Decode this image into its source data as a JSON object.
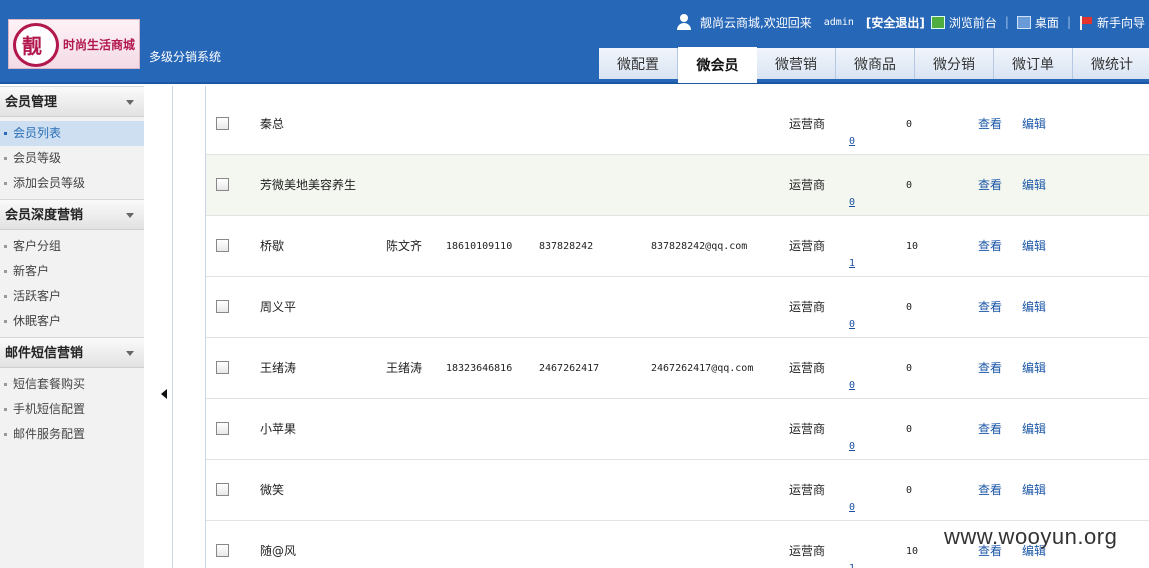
{
  "brand": {
    "logo_mark": "靓",
    "logo_text": "时尚生活商城",
    "system_name": "多级分销系统"
  },
  "topbar": {
    "welcome": "靓尚云商城,欢迎回来",
    "user": "admin",
    "logout": "[安全退出]",
    "browse_frontend": "浏览前台",
    "desktop": "桌面",
    "guide": "新手向导",
    "separator": "|"
  },
  "tabs": [
    {
      "label": "微配置",
      "active": false
    },
    {
      "label": "微会员",
      "active": true
    },
    {
      "label": "微营销",
      "active": false
    },
    {
      "label": "微商品",
      "active": false
    },
    {
      "label": "微分销",
      "active": false
    },
    {
      "label": "微订单",
      "active": false
    },
    {
      "label": "微统计",
      "active": false
    }
  ],
  "sidebar": {
    "groups": [
      {
        "title": "会员管理",
        "items": [
          {
            "label": "会员列表",
            "active": true
          },
          {
            "label": "会员等级",
            "active": false
          },
          {
            "label": "添加会员等级",
            "active": false
          }
        ]
      },
      {
        "title": "会员深度营销",
        "items": [
          {
            "label": "客户分组",
            "active": false
          },
          {
            "label": "新客户",
            "active": false
          },
          {
            "label": "活跃客户",
            "active": false
          },
          {
            "label": "休眠客户",
            "active": false
          }
        ]
      },
      {
        "title": "邮件短信营销",
        "items": [
          {
            "label": "短信套餐购买",
            "active": false
          },
          {
            "label": "手机短信配置",
            "active": false
          },
          {
            "label": "邮件服务配置",
            "active": false
          }
        ]
      }
    ]
  },
  "members": [
    {
      "nickname": "秦总",
      "realname": "",
      "phone": "",
      "qq": "",
      "email": "",
      "role": "运营商",
      "count": "0",
      "points": "0",
      "view": "查看",
      "edit": "编辑"
    },
    {
      "nickname": "芳微美地美容养生",
      "realname": "",
      "phone": "",
      "qq": "",
      "email": "",
      "role": "运营商",
      "count": "0",
      "points": "0",
      "view": "查看",
      "edit": "编辑"
    },
    {
      "nickname": "桥歇",
      "realname": "陈文齐",
      "phone": "18610109110",
      "qq": "837828242",
      "email": "837828242@qq.com",
      "role": "运营商",
      "count": "1",
      "points": "10",
      "view": "查看",
      "edit": "编辑"
    },
    {
      "nickname": "周义平",
      "realname": "",
      "phone": "",
      "qq": "",
      "email": "",
      "role": "运营商",
      "count": "0",
      "points": "0",
      "view": "查看",
      "edit": "编辑"
    },
    {
      "nickname": "王绪涛",
      "realname": "王绪涛",
      "phone": "18323646816",
      "qq": "2467262417",
      "email": "2467262417@qq.com",
      "role": "运营商",
      "count": "0",
      "points": "0",
      "view": "查看",
      "edit": "编辑"
    },
    {
      "nickname": "小苹果",
      "realname": "",
      "phone": "",
      "qq": "",
      "email": "",
      "role": "运营商",
      "count": "0",
      "points": "0",
      "view": "查看",
      "edit": "编辑"
    },
    {
      "nickname": "微笑",
      "realname": "",
      "phone": "",
      "qq": "",
      "email": "",
      "role": "运营商",
      "count": "0",
      "points": "0",
      "view": "查看",
      "edit": "编辑"
    },
    {
      "nickname": "随@风",
      "realname": "",
      "phone": "",
      "qq": "",
      "email": "",
      "role": "运营商",
      "count": "1",
      "points": "10",
      "view": "查看",
      "edit": "编辑"
    }
  ],
  "watermark": "www.wooyun.org"
}
